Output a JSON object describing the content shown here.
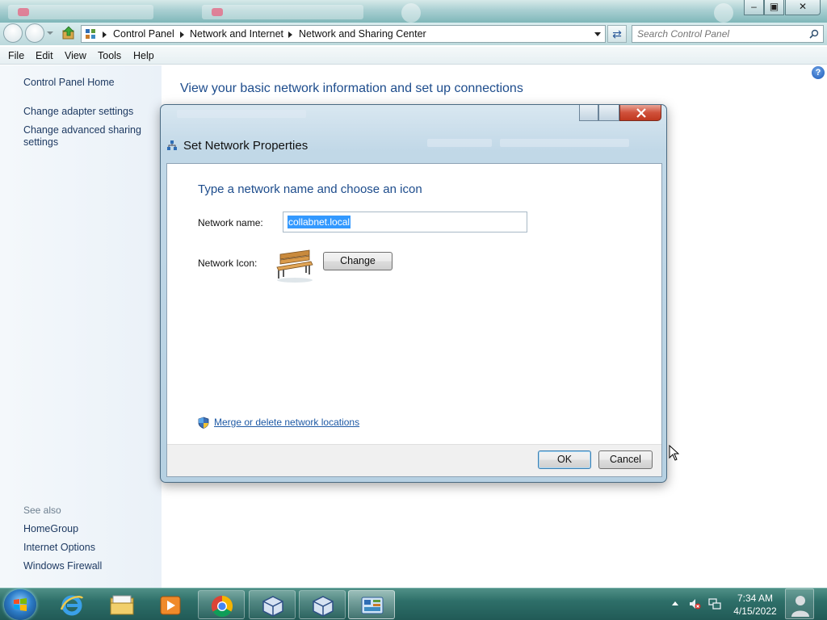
{
  "window": {
    "address": {
      "breadcrumbs": [
        "Control Panel",
        "Network and Internet",
        "Network and Sharing Center"
      ]
    },
    "search_placeholder": "Search Control Panel"
  },
  "menu": [
    "File",
    "Edit",
    "View",
    "Tools",
    "Help"
  ],
  "sidebar": {
    "home": "Control Panel Home",
    "links": [
      "Change adapter settings",
      "Change advanced sharing settings"
    ],
    "see_also_title": "See also",
    "see_also": [
      "HomeGroup",
      "Internet Options",
      "Windows Firewall"
    ]
  },
  "main": {
    "title": "View your basic network information and set up connections"
  },
  "dialog": {
    "title": "Set Network Properties",
    "heading": "Type a network name and choose an icon",
    "network_name_label": "Network name:",
    "network_name_value": "collabnet.local",
    "network_icon_label": "Network Icon:",
    "change_button": "Change",
    "merge_link": "Merge or delete network locations",
    "ok_button": "OK",
    "cancel_button": "Cancel"
  },
  "taskbar": {
    "pinned": [
      "internet-explorer-icon",
      "windows-explorer-icon",
      "media-player-icon",
      "chrome-icon",
      "virtualbox-icon",
      "virtualbox-icon",
      "control-panel-icon"
    ],
    "clock_time": "7:34 AM",
    "clock_date": "4/15/2022"
  },
  "colors": {
    "title_blue": "#1d4c8c",
    "link_blue": "#1f5aa5",
    "taskbar": "#2e6f69",
    "selection": "#3399ff"
  }
}
